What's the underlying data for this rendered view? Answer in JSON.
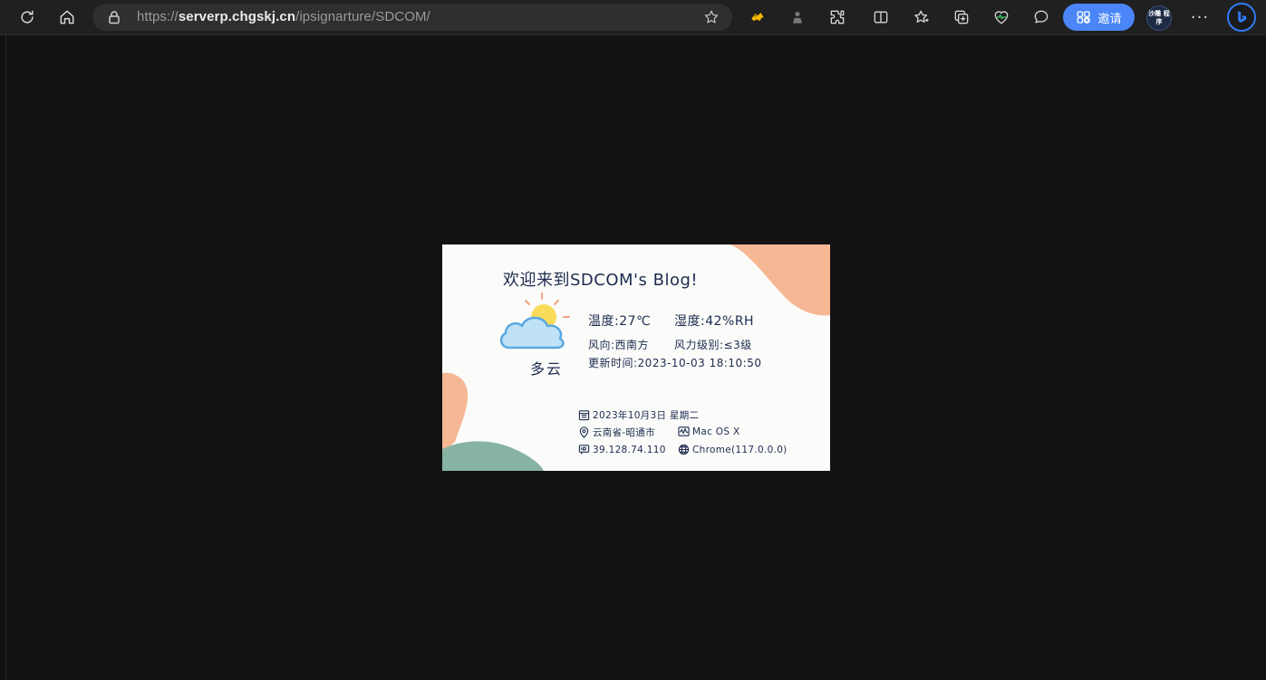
{
  "browser": {
    "url_prefix": "https://",
    "url_host": "serverp.chgskj.cn",
    "url_path": "/ipsignarture/SDCOM/",
    "invite_label": "邀请",
    "profile_text": "沙雕 程序"
  },
  "icons": {
    "refresh": "refresh-icon",
    "home": "home-icon",
    "lock": "lock-icon",
    "favorite": "star-icon",
    "extension_1": "extension-icon",
    "extension_2": "extension-icon",
    "extensions": "puzzle-icon",
    "split": "split-screen-icon",
    "favorites": "favorites-icon",
    "collections": "collections-icon",
    "performance": "heartbeat-icon",
    "feedback": "chat-icon",
    "copilot": "copilot-icon"
  },
  "card": {
    "welcome": "欢迎来到SDCOM's  Blog!",
    "condition": "多云",
    "temperature": "温度:27℃",
    "humidity": "湿度:42%RH",
    "wind_direction": "风向:西南方",
    "wind_level": "风力级别:≤3级",
    "updated": "更新时间:2023-10-03  18:10:50",
    "date": "2023年10月3日  星期二",
    "location": "云南省-昭通市",
    "os": "Mac  OS  X",
    "ip": "39.128.74.110",
    "browser": "Chrome(117.0.0.0)"
  },
  "colors": {
    "accent_blue": "#4a86f7",
    "blob_peach": "#f6b894",
    "blob_green": "#86b3a2",
    "text_navy": "#1d2b4f",
    "cloud_blue": "#bfe2f6",
    "sun_yellow": "#f9dc5c"
  }
}
